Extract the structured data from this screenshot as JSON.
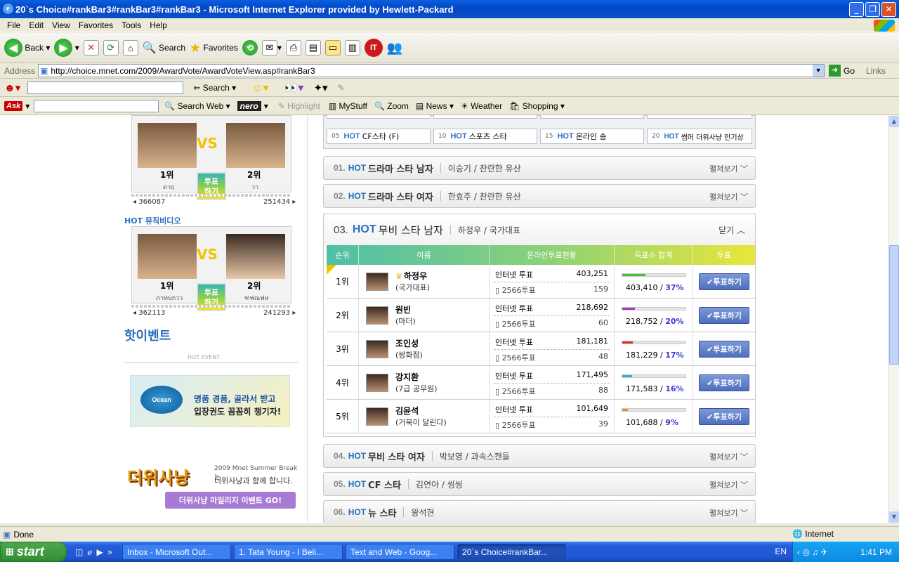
{
  "window": {
    "title": "20`s Choice#rankBar3#rankBar3#rankBar3 - Microsoft Internet Explorer provided by Hewlett-Packard",
    "min": "_",
    "max": "❐",
    "close": "✕"
  },
  "menu": [
    "File",
    "Edit",
    "View",
    "Favorites",
    "Tools",
    "Help"
  ],
  "toolbar": {
    "back": "Back",
    "search": "Search",
    "favorites": "Favorites"
  },
  "address": {
    "label": "Address",
    "url": "http://choice.mnet.com/2009/AwardVote/AwardVoteView.asp#rankBar3",
    "go": "Go",
    "links": "Links"
  },
  "yahoo": {
    "search": "Search"
  },
  "ask": {
    "logo": "Ask",
    "search_web": "Search Web",
    "nero": "nero",
    "highlight": "Highlight",
    "mystuff": "MyStuff",
    "zoom": "Zoom",
    "news": "News",
    "weather": "Weather",
    "shopping": "Shopping"
  },
  "left": {
    "box1": {
      "rank1": "1위",
      "rank2": "2위",
      "name1": "ดาฤ",
      "name2": "วา",
      "vote": "투표\n하기",
      "count1": "366087",
      "count2": "251434"
    },
    "box2_label": "HOT 뮤직비디오",
    "box2": {
      "rank1": "1위",
      "rank2": "2위",
      "name1": "ภาทปกวว",
      "name2": "ฑฟณฟห",
      "vote": "투표\n하기",
      "count1": "362113",
      "count2": "241293"
    },
    "event_title": "핫이벤트",
    "event_sub": "HOT EVENT",
    "ad1_line1": "명품 경품, 골라서 받고",
    "ad1_line2": "입장권도 꼼꼼히 챙기자!",
    "ad2_big": "더위사냥",
    "ad2_s1": "2009 Mnet Summer Break는",
    "ad2_s2": "더위사냥과 함께 합니다.",
    "ad2_go": "더위사냥 마일리지 이벤트 GO!"
  },
  "subcats": [
    {
      "n": "05",
      "label": "CF스타 (F)"
    },
    {
      "n": "10",
      "label": "스포츠 스타"
    },
    {
      "n": "15",
      "label": "온라인 송"
    },
    {
      "n": "20",
      "label": "썸머 더위사냥 인기상"
    }
  ],
  "categories": [
    {
      "num": "01.",
      "hot": "HOT",
      "title": "드라마 스타 남자",
      "winner": "이승기 / 찬란한 유산",
      "more": "펼쳐보기"
    },
    {
      "num": "02.",
      "hot": "HOT",
      "title": "드라마 스타 여자",
      "winner": "한효주 / 찬란한 유산",
      "more": "펼쳐보기"
    },
    {
      "num": "04.",
      "hot": "HOT",
      "title": "무비 스타 여자",
      "winner": "박보영 / 과속스캔들",
      "more": "펼쳐보기"
    },
    {
      "num": "05.",
      "hot": "HOT",
      "title": "CF 스타",
      "winner": "김연아 / 씽씽",
      "more": "펼쳐보기"
    },
    {
      "num": "06.",
      "hot": "HOT",
      "title": "뉴 스타",
      "winner": "왕석현",
      "more": "펼쳐보기"
    }
  ],
  "open_category": {
    "num": "03.",
    "hot": "HOT",
    "title": "무비 스타 남자",
    "winner": "하정우 / 국가대표",
    "collapse": "닫기",
    "headers": [
      "순위",
      "이름",
      "온라인투표현황",
      "득표수 합계",
      "투표"
    ],
    "rows": [
      {
        "rank": "1위",
        "name": "하정우",
        "work": "(국가대표)",
        "net_label": "인터넷 투표",
        "net": "403,251",
        "sms_label": "2566투표",
        "sms": "159",
        "total": "403,410",
        "pct": "37%",
        "pct_value": 37,
        "color": "#4bbf3b",
        "vote": "✔투표하기"
      },
      {
        "rank": "2위",
        "name": "원빈",
        "work": "(마더)",
        "net_label": "인터넷 투표",
        "net": "218,692",
        "sms_label": "2566투표",
        "sms": "60",
        "total": "218,752",
        "pct": "20%",
        "pct_value": 20,
        "color": "#a43bc4",
        "vote": "✔투표하기"
      },
      {
        "rank": "3위",
        "name": "조인성",
        "work": "(쌍화점)",
        "net_label": "인터넷 투표",
        "net": "181,181",
        "sms_label": "2566투표",
        "sms": "48",
        "total": "181,229",
        "pct": "17%",
        "pct_value": 17,
        "color": "#e0301e",
        "vote": "✔투표하기"
      },
      {
        "rank": "4위",
        "name": "강지환",
        "work": "(7급 공무원)",
        "net_label": "인터넷 투표",
        "net": "171,495",
        "sms_label": "2566투표",
        "sms": "88",
        "total": "171,583",
        "pct": "16%",
        "pct_value": 16,
        "color": "#3aa8e0",
        "vote": "✔투표하기"
      },
      {
        "rank": "5위",
        "name": "김윤석",
        "work": "(거북이 달린다)",
        "net_label": "인터넷 투표",
        "net": "101,649",
        "sms_label": "2566투표",
        "sms": "39",
        "total": "101,688",
        "pct": "9%",
        "pct_value": 9,
        "color": "#f08a1e",
        "vote": "✔투표하기"
      }
    ]
  },
  "status": {
    "done": "Done",
    "zone": "Internet"
  },
  "taskbar": {
    "start": "start",
    "tasks": [
      "Inbox - Microsoft Out...",
      "1. Tata Young - I Beli...",
      "Text and Web - Goog...",
      "20`s Choice#rankBar..."
    ],
    "lang": "EN",
    "clock": "1:41 PM"
  }
}
